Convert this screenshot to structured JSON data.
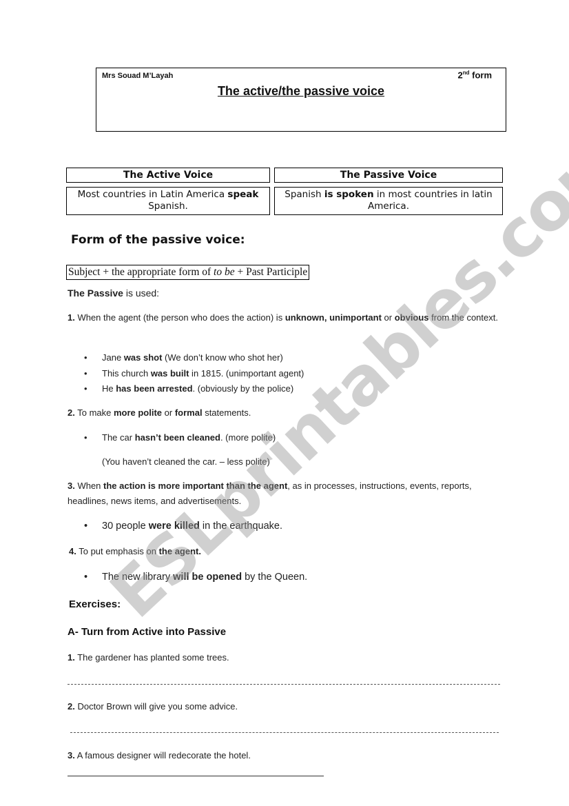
{
  "header": {
    "author": "Mrs Souad M’Layah",
    "form_number": "2",
    "form_suffix": "nd",
    "form_word": "form",
    "title": "The active/the passive voice"
  },
  "comparison_table": {
    "headers": [
      "The Active Voice",
      "The Passive Voice"
    ],
    "active_example": {
      "before": "Most countries in Latin America ",
      "bold": "speak",
      "after": " Spanish."
    },
    "passive_example": {
      "before": "Spanish ",
      "bold": "is spoken",
      "after": " in most countries in latin America."
    }
  },
  "form_section": {
    "title": "Form of the passive voice:",
    "formula_start": "Subject + the appropriate form of ",
    "formula_italic": "to be",
    "formula_end": " + Past Participle"
  },
  "usage": {
    "intro_bold": "The Passive",
    "intro_rest": " is used:",
    "rules": [
      {
        "num": "1.",
        "parts": [
          " When the agent (the person who does the action) is ",
          "unknown, unimportant",
          " or ",
          "obvious",
          " from the context."
        ],
        "examples": [
          {
            "before": "Jane ",
            "bold": "was shot",
            "after": " (We don’t know who shot her)"
          },
          {
            "before": "This church ",
            "bold": "was built",
            "after": " in 1815. (unimportant agent)"
          },
          {
            "before": "He ",
            "bold": "has been arrested",
            "after": ". (obviously by the police)"
          }
        ]
      },
      {
        "num": "2.",
        "parts": [
          " To make ",
          "more polite",
          " or ",
          "formal",
          " statements."
        ],
        "examples": [
          {
            "before": "The car ",
            "bold": "hasn’t been cleaned",
            "after": ". (more polite)"
          }
        ],
        "note": "(You haven’t cleaned the car. – less polite)"
      },
      {
        "num": "3.",
        "parts": [
          " When ",
          "the action is more important than the agent",
          ", as in processes, instructions, events, reports, headlines, news items, and advertisements."
        ],
        "examples": [
          {
            "before": "30 people ",
            "bold": "were killed",
            "after": " in the earthquake."
          }
        ]
      },
      {
        "num": "4.",
        "parts": [
          " To put emphasis on ",
          "the agent."
        ],
        "examples": [
          {
            "before": "The new library ",
            "bold": "will be opened",
            "after": " by the Queen."
          }
        ]
      }
    ],
    "bullet_glyph": "•"
  },
  "exercises": {
    "title": "Exercises:",
    "section_a": "A- Turn from Active into Passive",
    "questions": [
      {
        "num": "1.",
        "text": " The gardener has planted some trees."
      },
      {
        "num": "2.",
        "text": " Doctor Brown will give you some advice."
      },
      {
        "num": "3.",
        "text": " A famous designer will redecorate the hotel."
      }
    ]
  },
  "watermark": "ESLprintables.com"
}
